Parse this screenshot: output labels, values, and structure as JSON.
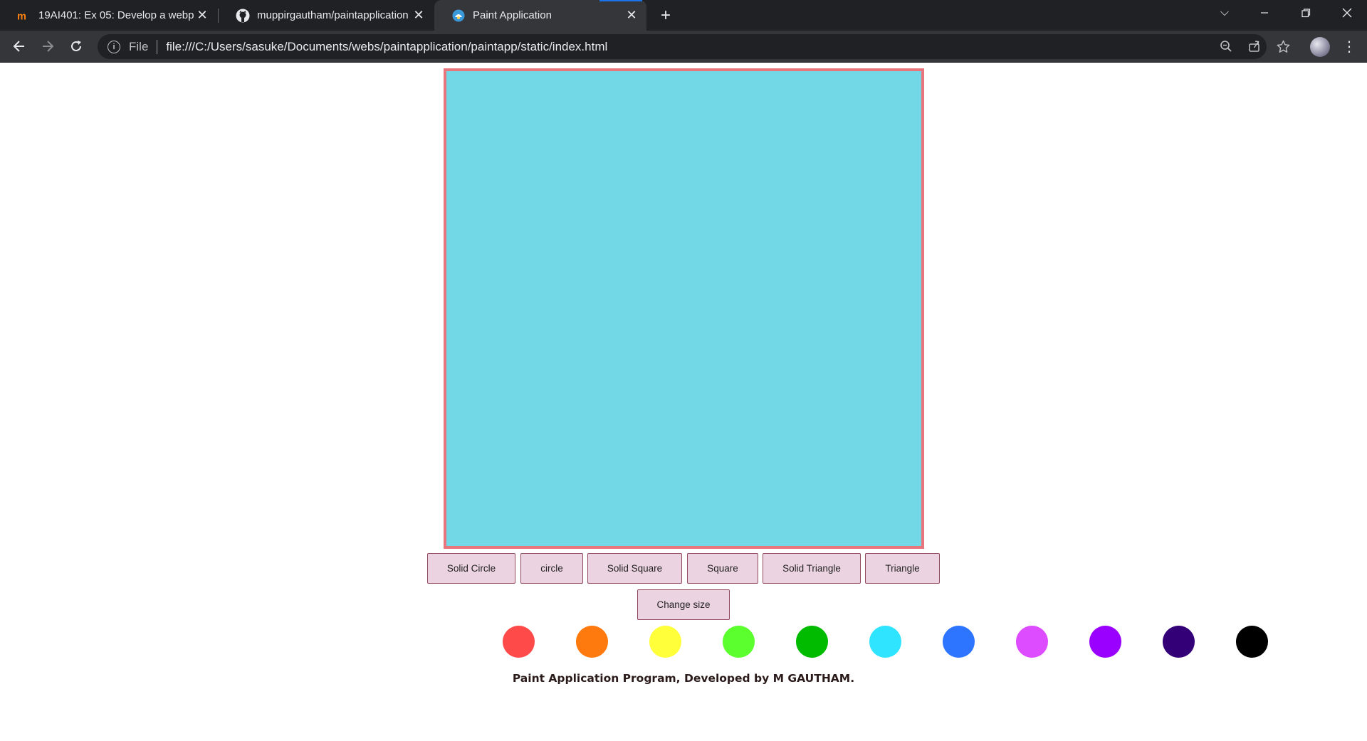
{
  "browser": {
    "tabs": [
      {
        "title": "19AI401: Ex 05: Develop a webpa",
        "icon": "moodle-icon"
      },
      {
        "title": "muppirgautham/paintapplication",
        "icon": "github-icon"
      },
      {
        "title": "Paint Application",
        "icon": "app-icon",
        "active": true
      }
    ],
    "new_tab_label": "+",
    "address": {
      "scheme_label": "File",
      "url": "file:///C:/Users/sasuke/Documents/webs/paintapplication/paintapp/static/index.html"
    }
  },
  "app": {
    "canvas_color": "#72d8e6",
    "canvas_border_color": "#e8757b",
    "shape_buttons": [
      {
        "label": "Solid Circle"
      },
      {
        "label": "circle"
      },
      {
        "label": "Solid Square"
      },
      {
        "label": "Square"
      },
      {
        "label": "Solid Triangle"
      },
      {
        "label": "Triangle"
      }
    ],
    "size_button_label": "Change size",
    "colors": [
      "#ff4a4a",
      "#ff7a0e",
      "#ffff3a",
      "#5cff2e",
      "#00bb00",
      "#2ee4ff",
      "#2d74ff",
      "#dd4cff",
      "#9a00ff",
      "#330077",
      "#000000"
    ],
    "footer": "Paint Application Program, Developed by M GAUTHAM."
  }
}
